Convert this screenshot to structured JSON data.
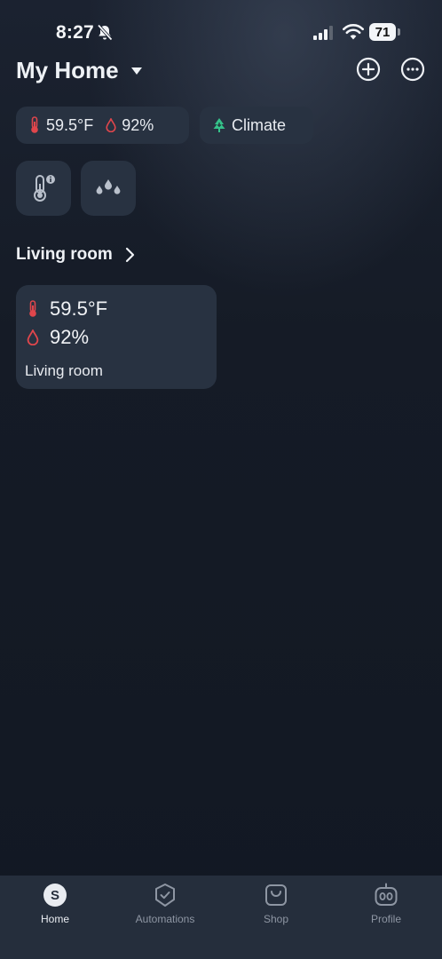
{
  "status_bar": {
    "time": "8:27",
    "battery": "71",
    "icons": [
      "bell-slash-icon",
      "cellular-signal-icon",
      "wifi-icon",
      "battery-icon"
    ]
  },
  "header": {
    "title": "My Home",
    "icons": [
      "caret-down-icon",
      "add-circle-icon",
      "more-circle-icon"
    ]
  },
  "summary": {
    "temperature": "59.5°F",
    "humidity": "92%",
    "climate_label": "Climate"
  },
  "quick_tiles": [
    {
      "icon": "thermometer-info-icon"
    },
    {
      "icon": "water-drops-icon"
    }
  ],
  "section": {
    "title": "Living room"
  },
  "room_card": {
    "temperature": "59.5°F",
    "humidity": "92%",
    "name": "Living room"
  },
  "tabs": [
    {
      "label": "Home",
      "avatar_letter": "S",
      "active": true
    },
    {
      "label": "Automations",
      "icon": "shield-check-icon",
      "active": false
    },
    {
      "label": "Shop",
      "icon": "shopping-bag-icon",
      "active": false
    },
    {
      "label": "Profile",
      "icon": "robot-icon",
      "active": false
    }
  ],
  "colors": {
    "temp_red": "#e0464c",
    "climate_green": "#35c28a",
    "card_bg": "#283241",
    "tab_bar_bg": "#252e3c"
  }
}
